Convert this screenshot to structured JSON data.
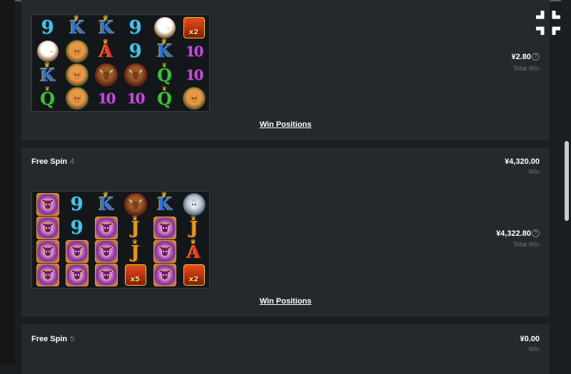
{
  "rounds": [
    {
      "total_win": "¥2.80",
      "total_win_label": "Total Win",
      "win_positions_label": "Win Positions",
      "grid": [
        [
          "9",
          "K",
          "K",
          "9",
          "eagle",
          "mult-x2"
        ],
        [
          "eagle",
          "cougar",
          "A",
          "9",
          "K",
          "10"
        ],
        [
          "K",
          "cougar",
          "moose",
          "moose",
          "Q",
          "10"
        ],
        [
          "Q",
          "cougar",
          "10",
          "10",
          "Q",
          "cougar"
        ]
      ]
    },
    {
      "title": "Free Spin",
      "spin_number": "4",
      "win": "¥4,320.00",
      "win_label": "Win",
      "total_win": "¥4,322.80",
      "total_win_label": "Total Win",
      "win_positions_label": "Win Positions",
      "grid": [
        [
          "buffalo",
          "9",
          "K",
          "moose",
          "K",
          "wolf"
        ],
        [
          "buffalo",
          "9",
          "buffalo",
          "J",
          "buffalo",
          "J"
        ],
        [
          "buffalo",
          "buffalo",
          "buffalo",
          "J",
          "buffalo",
          "A"
        ],
        [
          "buffalo",
          "buffalo",
          "buffalo",
          "mult-x5",
          "buffalo",
          "mult-x2"
        ]
      ]
    },
    {
      "title": "Free Spin",
      "spin_number": "5",
      "win": "¥0.00",
      "win_label": "Win"
    }
  ],
  "help_glyph": "?",
  "multipliers": {
    "x2": "x2",
    "x5": "x5"
  },
  "icons": {
    "fullscreen_exit": "exit-fullscreen-icon",
    "help": "help-icon"
  },
  "colors": {
    "panel": "#25292b",
    "background": "#1b1e20",
    "muted_text": "#6d7376"
  }
}
